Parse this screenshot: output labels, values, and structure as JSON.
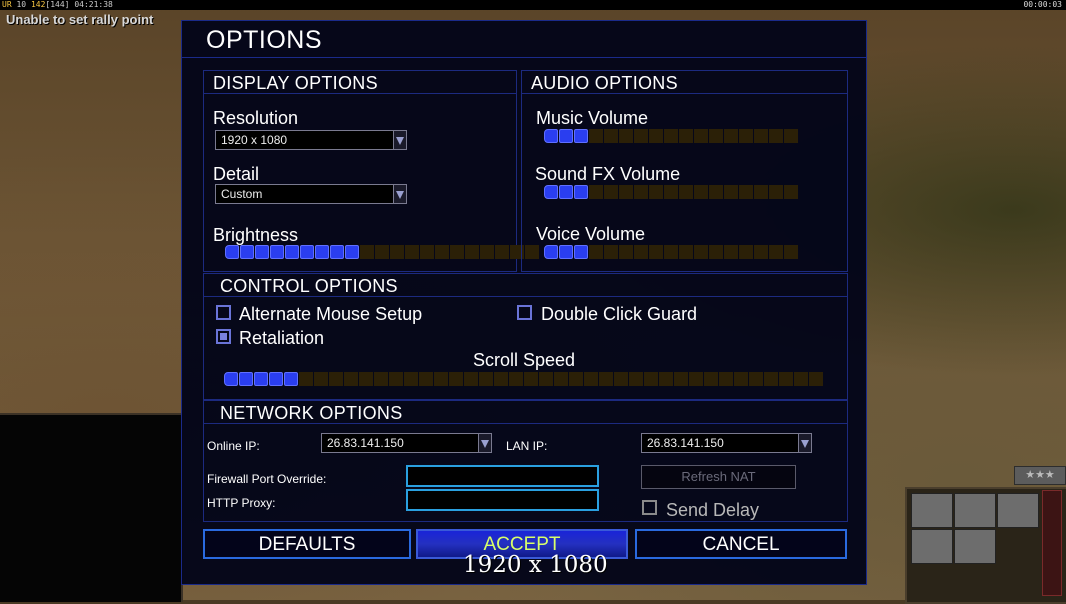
{
  "hud": {
    "top_left_code": "UR",
    "top_left_level": "10",
    "top_left_value1": "142",
    "top_left_value2": "[144]",
    "top_left_time": "04:21:38",
    "top_right_time": "00:00:03",
    "rally_message": "Unable to set rally point",
    "rank_stars": "★★★"
  },
  "dialog": {
    "title": "OPTIONS",
    "display": {
      "header": "DISPLAY OPTIONS",
      "resolution_label": "Resolution",
      "resolution_value": "1920 x 1080",
      "detail_label": "Detail",
      "detail_value": "Custom",
      "brightness_label": "Brightness",
      "brightness_level": 9,
      "brightness_segments": 21
    },
    "audio": {
      "header": "AUDIO OPTIONS",
      "music_label": "Music Volume",
      "music_level": 3,
      "sfx_label": "Sound FX Volume",
      "sfx_level": 3,
      "voice_label": "Voice Volume",
      "voice_level": 3,
      "segments": 17
    },
    "control": {
      "header": "CONTROL OPTIONS",
      "alt_mouse_label": "Alternate Mouse Setup",
      "alt_mouse_checked": false,
      "double_click_label": "Double Click Guard",
      "double_click_checked": false,
      "retaliation_label": "Retaliation",
      "retaliation_checked": true,
      "scroll_label": "Scroll Speed",
      "scroll_level": 5,
      "scroll_segments": 40
    },
    "network": {
      "header": "NETWORK OPTIONS",
      "online_ip_label": "Online IP:",
      "online_ip_value": "26.83.141.150",
      "lan_ip_label": "LAN IP:",
      "lan_ip_value": "26.83.141.150",
      "firewall_label": "Firewall Port Override:",
      "http_proxy_label": "HTTP Proxy:",
      "refresh_nat_label": "Refresh NAT",
      "send_delay_label": "Send Delay",
      "send_delay_checked": false
    },
    "buttons": {
      "defaults": "DEFAULTS",
      "accept": "ACCEPT",
      "cancel": "CANCEL"
    }
  },
  "overlay_resolution": "1920 x 1080",
  "colors": {
    "slider_on": "#2a3ef0",
    "slider_off": "#2b2007",
    "accept_text": "#d8ff6a",
    "panel_border": "#1a2a8a"
  }
}
